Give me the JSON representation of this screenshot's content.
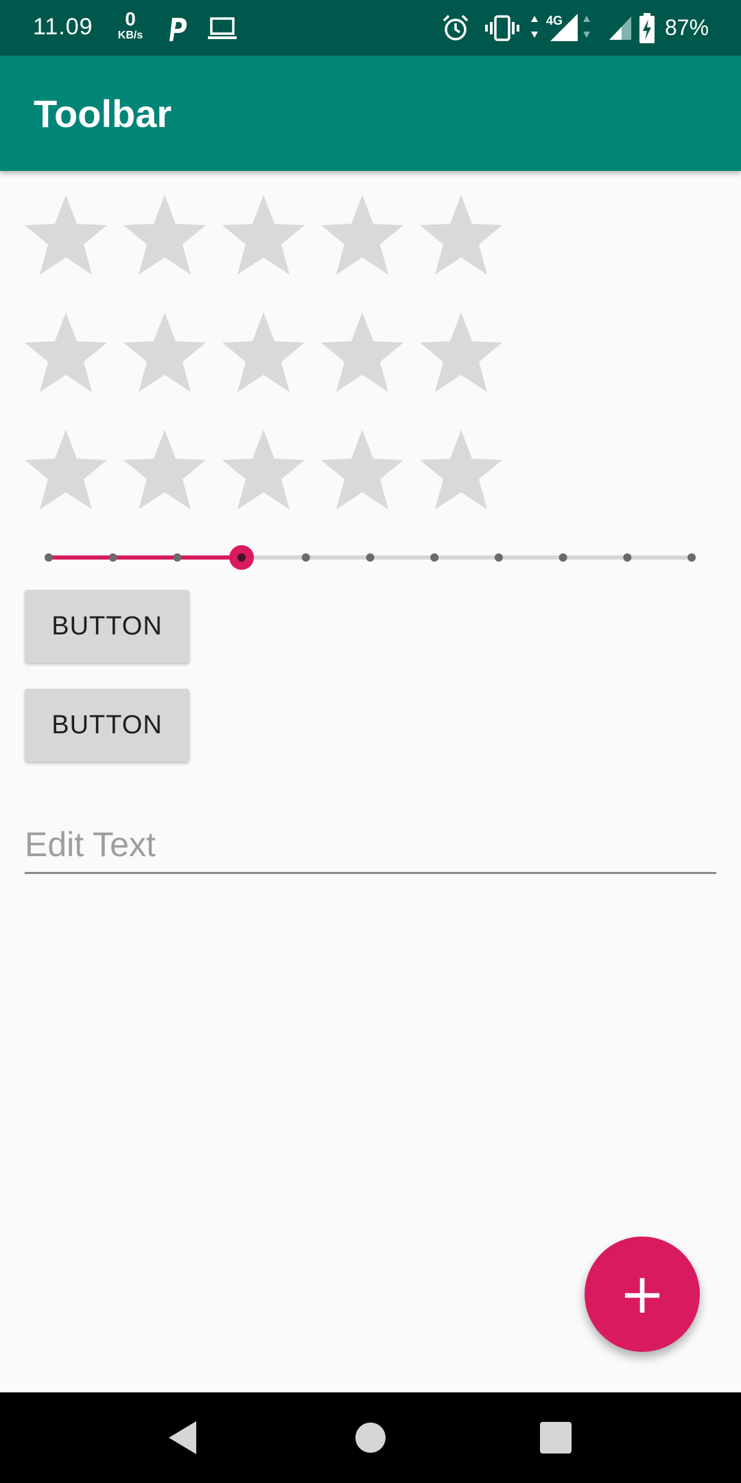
{
  "status_bar": {
    "time": "11.09",
    "net_speed_value": "0",
    "net_speed_unit": "KB/s",
    "battery_percent": "87%",
    "icons": [
      "p-notification-icon",
      "laptop-icon",
      "alarm-icon",
      "vibrate-icon",
      "data-arrows-icon",
      "4g-signal-icon",
      "signal-icon",
      "battery-charging-icon"
    ]
  },
  "toolbar": {
    "title": "Toolbar"
  },
  "rating_bars": [
    {
      "max_stars": 5,
      "rating": 0
    },
    {
      "max_stars": 5,
      "rating": 0
    },
    {
      "max_stars": 5,
      "rating": 0
    }
  ],
  "slider": {
    "ticks": 11,
    "value": 3,
    "max": 10
  },
  "buttons": [
    {
      "label": "BUTTON"
    },
    {
      "label": "BUTTON"
    }
  ],
  "edit_text": {
    "placeholder": "Edit Text",
    "value": ""
  },
  "fab": {
    "icon": "plus-icon",
    "symbol": "+"
  },
  "nav_bar": {
    "icons": [
      "back-icon",
      "home-icon",
      "recents-icon"
    ]
  },
  "colors": {
    "status_bar": "#00574b",
    "toolbar": "#008577",
    "accent": "#d81b60",
    "star_empty": "#d9d9d9",
    "background": "#fafafa"
  }
}
